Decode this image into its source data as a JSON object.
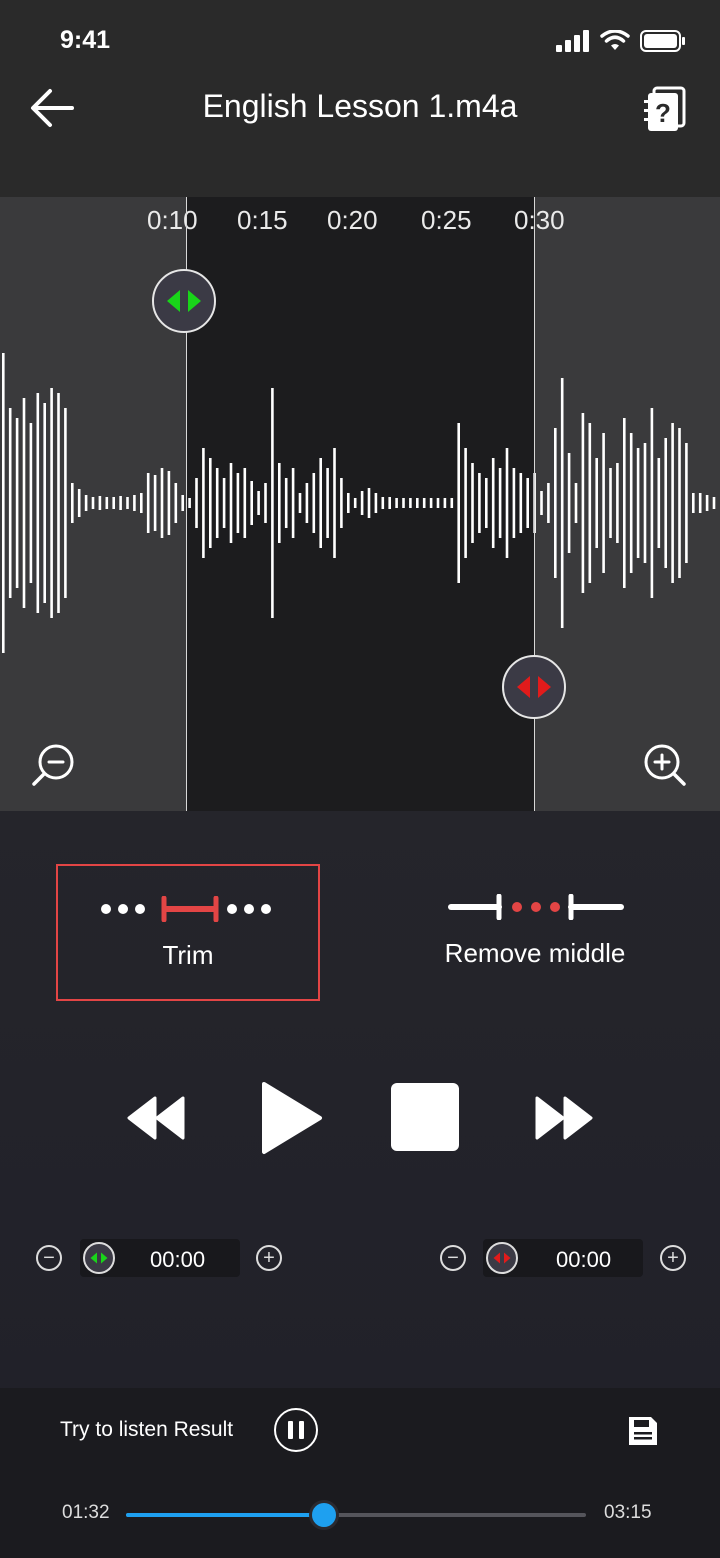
{
  "status_bar": {
    "time": "9:41"
  },
  "header": {
    "title": "English Lesson 1.m4a"
  },
  "timeline": {
    "ticks": [
      "0:10",
      "0:15",
      "0:20",
      "0:25",
      "0:30"
    ]
  },
  "edit_modes": {
    "trim_label": "Trim",
    "remove_middle_label": "Remove middle",
    "selected": "Trim"
  },
  "steppers": {
    "start_time": "00:00",
    "end_time": "00:00"
  },
  "result": {
    "label": "Try to listen Result",
    "current_time": "01:32",
    "total_time": "03:15",
    "progress": 0.43
  },
  "colors": {
    "accent_blue": "#1ea0f0",
    "start_handle_green": "#19d419",
    "end_handle_red": "#e11b1b",
    "selection_red": "#e34545"
  },
  "icons": {
    "back": "arrow-left-icon",
    "help": "help-document-icon",
    "zoom_out": "zoom-out-icon",
    "zoom_in": "zoom-in-icon",
    "rewind": "rewind-icon",
    "play": "play-icon",
    "stop": "stop-icon",
    "fast_forward": "fast-forward-icon",
    "pause": "pause-icon",
    "save": "save-icon"
  }
}
